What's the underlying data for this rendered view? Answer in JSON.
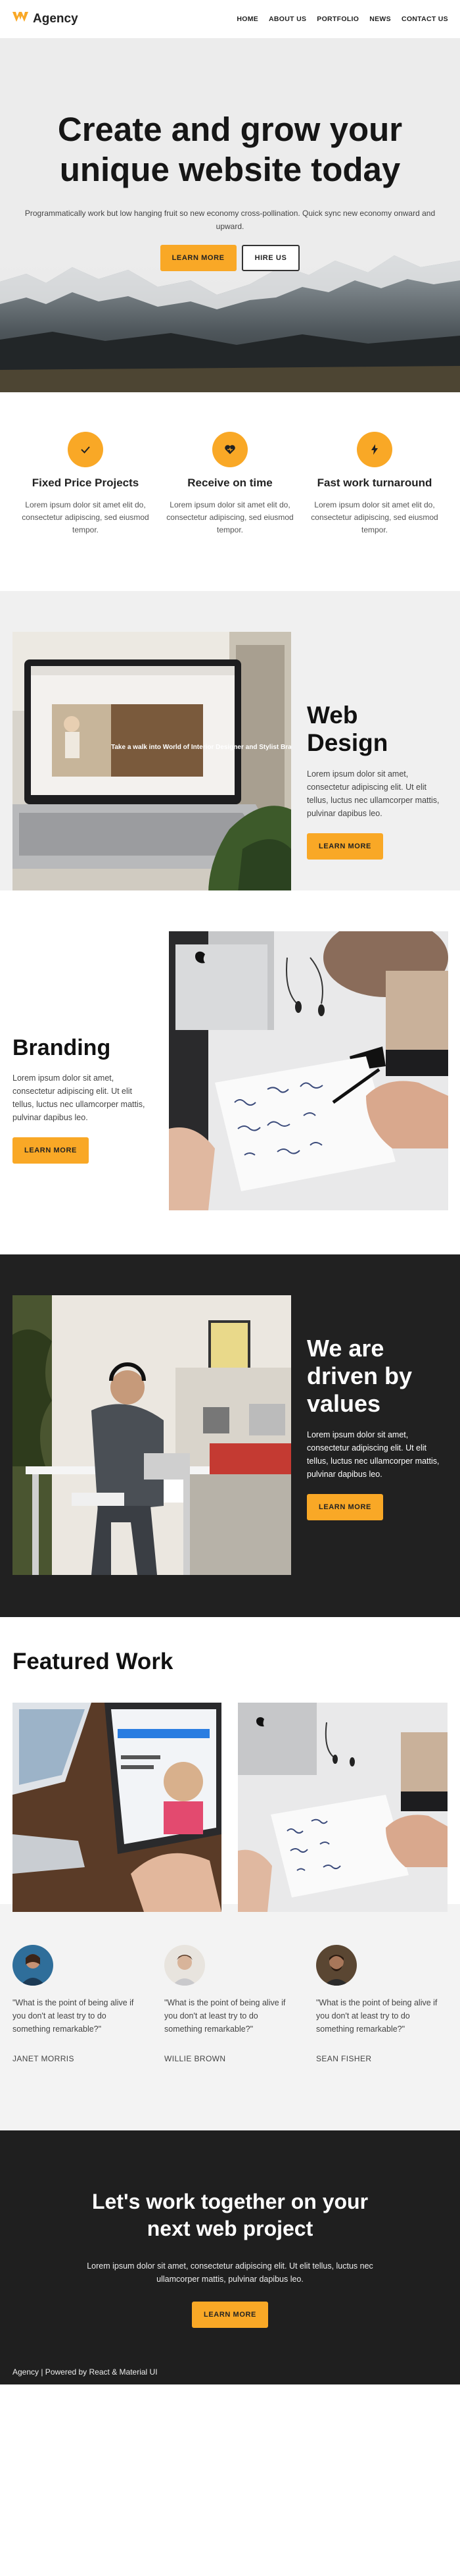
{
  "nav": {
    "brand": "Agency",
    "links": [
      "HOME",
      "ABOUT US",
      "PORTFOLIO",
      "NEWS",
      "CONTACT US"
    ]
  },
  "hero": {
    "title_line1": "Create and grow your",
    "title_line2": "unique website today",
    "subtitle": "Programmatically work but low hanging fruit so new economy cross-pollination. Quick sync new economy onward and upward.",
    "primary_button": "LEARN MORE",
    "secondary_button": "HIRE US"
  },
  "features": [
    {
      "icon": "check-icon",
      "title": "Fixed Price Projects",
      "text": "Lorem ipsum dolor sit amet elit do, consectetur adipiscing, sed eiusmod tempor."
    },
    {
      "icon": "heart-icon",
      "title": "Receive on time",
      "text": "Lorem ipsum dolor sit amet elit do, consectetur adipiscing, sed eiusmod tempor."
    },
    {
      "icon": "lightning-icon",
      "title": "Fast work turnaround",
      "text": "Lorem ipsum dolor sit amet elit do, consectetur adipiscing, sed eiusmod tempor."
    }
  ],
  "web_design": {
    "title": "Web Design",
    "text": "Lorem ipsum dolor sit amet, consectetur adipiscing elit. Ut elit tellus, luctus nec ullamcorper mattis, pulvinar dapibus leo.",
    "button": "LEARN MORE",
    "screen_caption": "Take a walk into World of Interior Designer and Stylist Brady Holland"
  },
  "branding": {
    "title": "Branding",
    "text": "Lorem ipsum dolor sit amet, consectetur adipiscing elit. Ut elit tellus, luctus nec ullamcorper mattis, pulvinar dapibus leo.",
    "button": "LEARN MORE"
  },
  "values": {
    "title_line1": "We are",
    "title_line2": "driven by",
    "title_line3": "values",
    "text": "Lorem ipsum dolor sit amet, consectetur adipiscing elit. Ut elit tellus, luctus nec ullamcorper mattis, pulvinar dapibus leo.",
    "button": "LEARN MORE"
  },
  "featured_work": {
    "title": "Featured Work"
  },
  "testimonials": [
    {
      "quote": "\"What is the point of being alive if you don't at least try to do something remarkable?\"",
      "name": "JANET MORRIS"
    },
    {
      "quote": "\"What is the point of being alive if you don't at least try to do something remarkable?\"",
      "name": "WILLIE BROWN"
    },
    {
      "quote": "\"What is the point of being alive if you don't at least try to do something remarkable?\"",
      "name": "SEAN FISHER"
    }
  ],
  "cta": {
    "title_line1": "Let's work together on your",
    "title_line2": "next web project",
    "text": "Lorem ipsum dolor sit amet, consectetur adipiscing elit. Ut elit tellus, luctus nec ullamcorper mattis, pulvinar dapibus leo.",
    "button": "LEARN MORE"
  },
  "footer": {
    "text": "Agency | Powered by React & Material UI"
  },
  "colors": {
    "accent": "#f9a826",
    "dark": "#212121",
    "light_bg": "#f0f0f0"
  }
}
